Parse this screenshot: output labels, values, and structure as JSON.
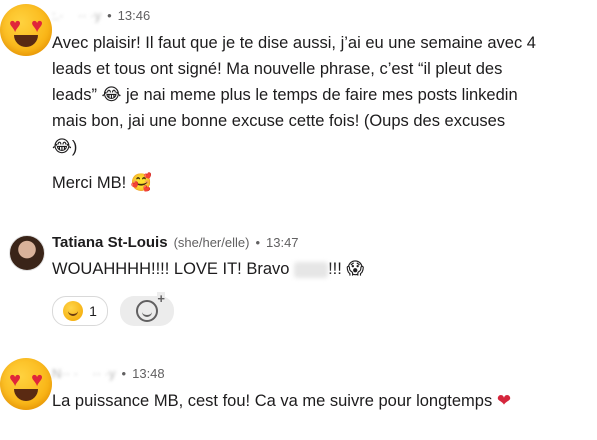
{
  "messages": [
    {
      "author": "",
      "timestamp": "13:46",
      "lines": [
        "Avec plaisir! Il faut que je te dise aussi, j’ai eu une semaine avec 4",
        "leads et tous ont signé! Ma nouvelle phrase, c’est “il pleut des",
        "leads”",
        "je nai meme plus le temps de faire mes posts linkedin",
        "mais bon, jai une bonne excuse cette fois! (Oups des excuses",
        ")",
        "Merci MB!"
      ],
      "emojis": {
        "laugh": "😂",
        "smiling_hearts": "🥰"
      }
    },
    {
      "author": "Tatiana St-Louis",
      "pronouns": "(she/her/elle)",
      "timestamp": "13:47",
      "text_before": "WOUAHHHH!!!! LOVE IT! Bravo",
      "text_after": "!!!",
      "emoji": "😱",
      "reactions": [
        {
          "emoji": "smile",
          "count": "1"
        }
      ],
      "add_reaction_icon": "add-reaction-icon"
    },
    {
      "author": "",
      "timestamp": "13:48",
      "text": "La puissance MB, cest fou! Ca va me  suivre pour longtemps",
      "emoji": "❤"
    }
  ],
  "separator": "•"
}
